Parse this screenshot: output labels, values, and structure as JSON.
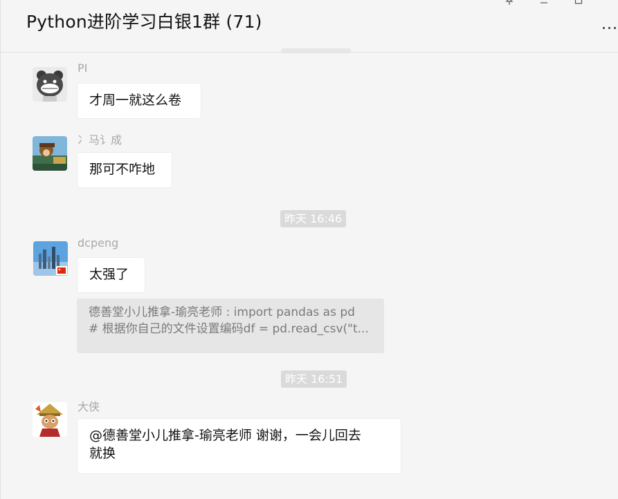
{
  "header": {
    "title": "Python进阶学习白银1群 (71)",
    "pin_icon": "pin-icon",
    "minimize_icon": "minimize-icon",
    "maximize_icon": "maximize-icon",
    "more_icon": "more-dots-icon"
  },
  "messages": {
    "m1": {
      "sender": "PI",
      "text": "才周一就这么卷"
    },
    "m2": {
      "sender": "冫马讠成",
      "text": "那可不咋地"
    },
    "t1": "昨天 16:46",
    "m3": {
      "sender": "dcpeng",
      "text": "太强了",
      "quote_line1": "德善堂小儿推拿-瑜亮老师 : import pandas as pd",
      "quote_line2": "# 根据你自己的文件设置编码df = pd.read_csv(\"t..."
    },
    "t2": "昨天 16:51",
    "m4": {
      "sender": "大侠",
      "text_line1": "@德善堂小儿推拿-瑜亮老师 谢谢，一会儿回去",
      "text_line2": "就换"
    }
  },
  "colors": {
    "background": "#f5f5f5",
    "bubble": "#ffffff",
    "time_pill": "#dadada",
    "quote": "#e6e6e6"
  }
}
